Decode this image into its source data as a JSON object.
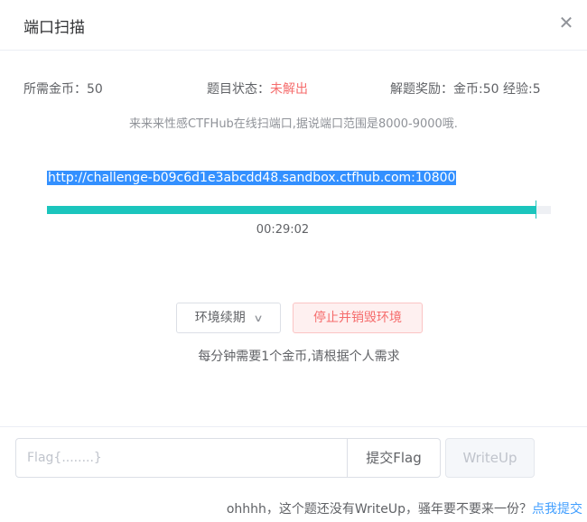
{
  "dialog": {
    "title": "端口扫描",
    "close_icon": "close-icon"
  },
  "info": {
    "coins_label": "所需金币：50",
    "status_label": "题目状态：",
    "status_value": "未解出",
    "reward_label": "解题奖励：金币:50 经验:5"
  },
  "description": "来来来性感CTFHub在线扫端口,据说端口范围是8000-9000哦.",
  "environment": {
    "url": "http://challenge-b09c6d1e3abcdd48.sandbox.ctfhub.com:10800",
    "remaining_time": "00:29:02",
    "progress_fraction": 0.97
  },
  "actions": {
    "renew_label": "环境续期",
    "renew_icon": "chevron-down-icon",
    "stop_label": "停止并销毁环境",
    "hint": "每分钟需要1个金币,请根据个人需求"
  },
  "flag_form": {
    "placeholder": "Flag{........}",
    "submit_label": "提交Flag",
    "writeup_label": "WriteUp"
  },
  "footer": {
    "text": "ohhhh，这个题还没有WriteUp，骚年要不要来一份？",
    "link": "点我提交"
  },
  "colors": {
    "status_red": "#f56c6c",
    "progress_teal": "#1bc5bd",
    "selection_blue": "#3390ff",
    "link_blue": "#409eff"
  }
}
